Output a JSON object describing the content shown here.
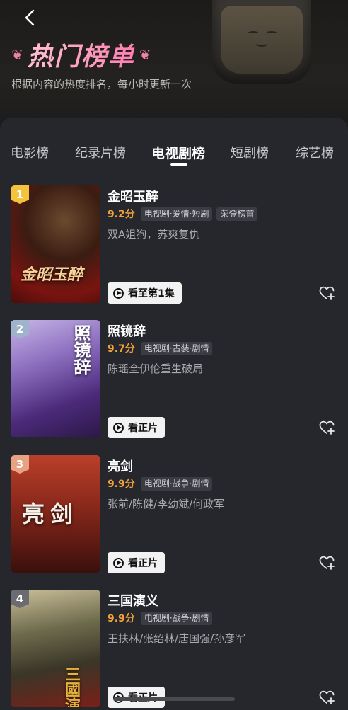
{
  "header": {
    "back_icon": "chevron-left-icon",
    "title": "热门榜单",
    "subtitle": "根据内容的热度排名，每小时更新一次"
  },
  "tabs": [
    {
      "label": "电影榜",
      "active": false
    },
    {
      "label": "纪录片榜",
      "active": false
    },
    {
      "label": "电视剧榜",
      "active": true
    },
    {
      "label": "短剧榜",
      "active": false
    },
    {
      "label": "综艺榜",
      "active": false
    }
  ],
  "items": [
    {
      "rank": "1",
      "rank_color": "#f5c33b",
      "title": "金昭玉醉",
      "score": "9.2分",
      "tags": [
        "电视剧·爱情·短剧",
        "荣登榜首"
      ],
      "desc": "双A姐狗，苏爽复仇",
      "button": "看至第1集",
      "poster_text": "金昭玉醉"
    },
    {
      "rank": "2",
      "rank_color": "#9fb3cc",
      "title": "照镜辞",
      "score": "9.7分",
      "tags": [
        "电视剧·古装·剧情"
      ],
      "desc": "陈瑶全伊伦重生破局",
      "button": "看正片",
      "poster_text": "照镜辞"
    },
    {
      "rank": "3",
      "rank_color": "#e8a182",
      "title": "亮剑",
      "score": "9.9分",
      "tags": [
        "电视剧·战争·剧情"
      ],
      "desc": "张前/陈健/李幼斌/何政军",
      "button": "看正片",
      "poster_text": "亮剑"
    },
    {
      "rank": "4",
      "rank_color": "#6b6b72",
      "title": "三国演义",
      "score": "9.9分",
      "tags": [
        "电视剧·战争·剧情"
      ],
      "desc": "王扶林/张绍林/唐国强/孙彦军",
      "button": "看正片",
      "poster_text": "三國演義"
    }
  ]
}
